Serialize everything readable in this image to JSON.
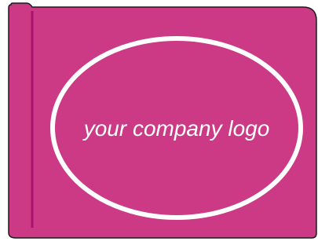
{
  "logo": {
    "text": "your company logo"
  },
  "colors": {
    "cover": "#cc3a85",
    "spine_line": "#a8126c",
    "outline": "#1a1a1a",
    "ellipse": "#ffffff"
  }
}
